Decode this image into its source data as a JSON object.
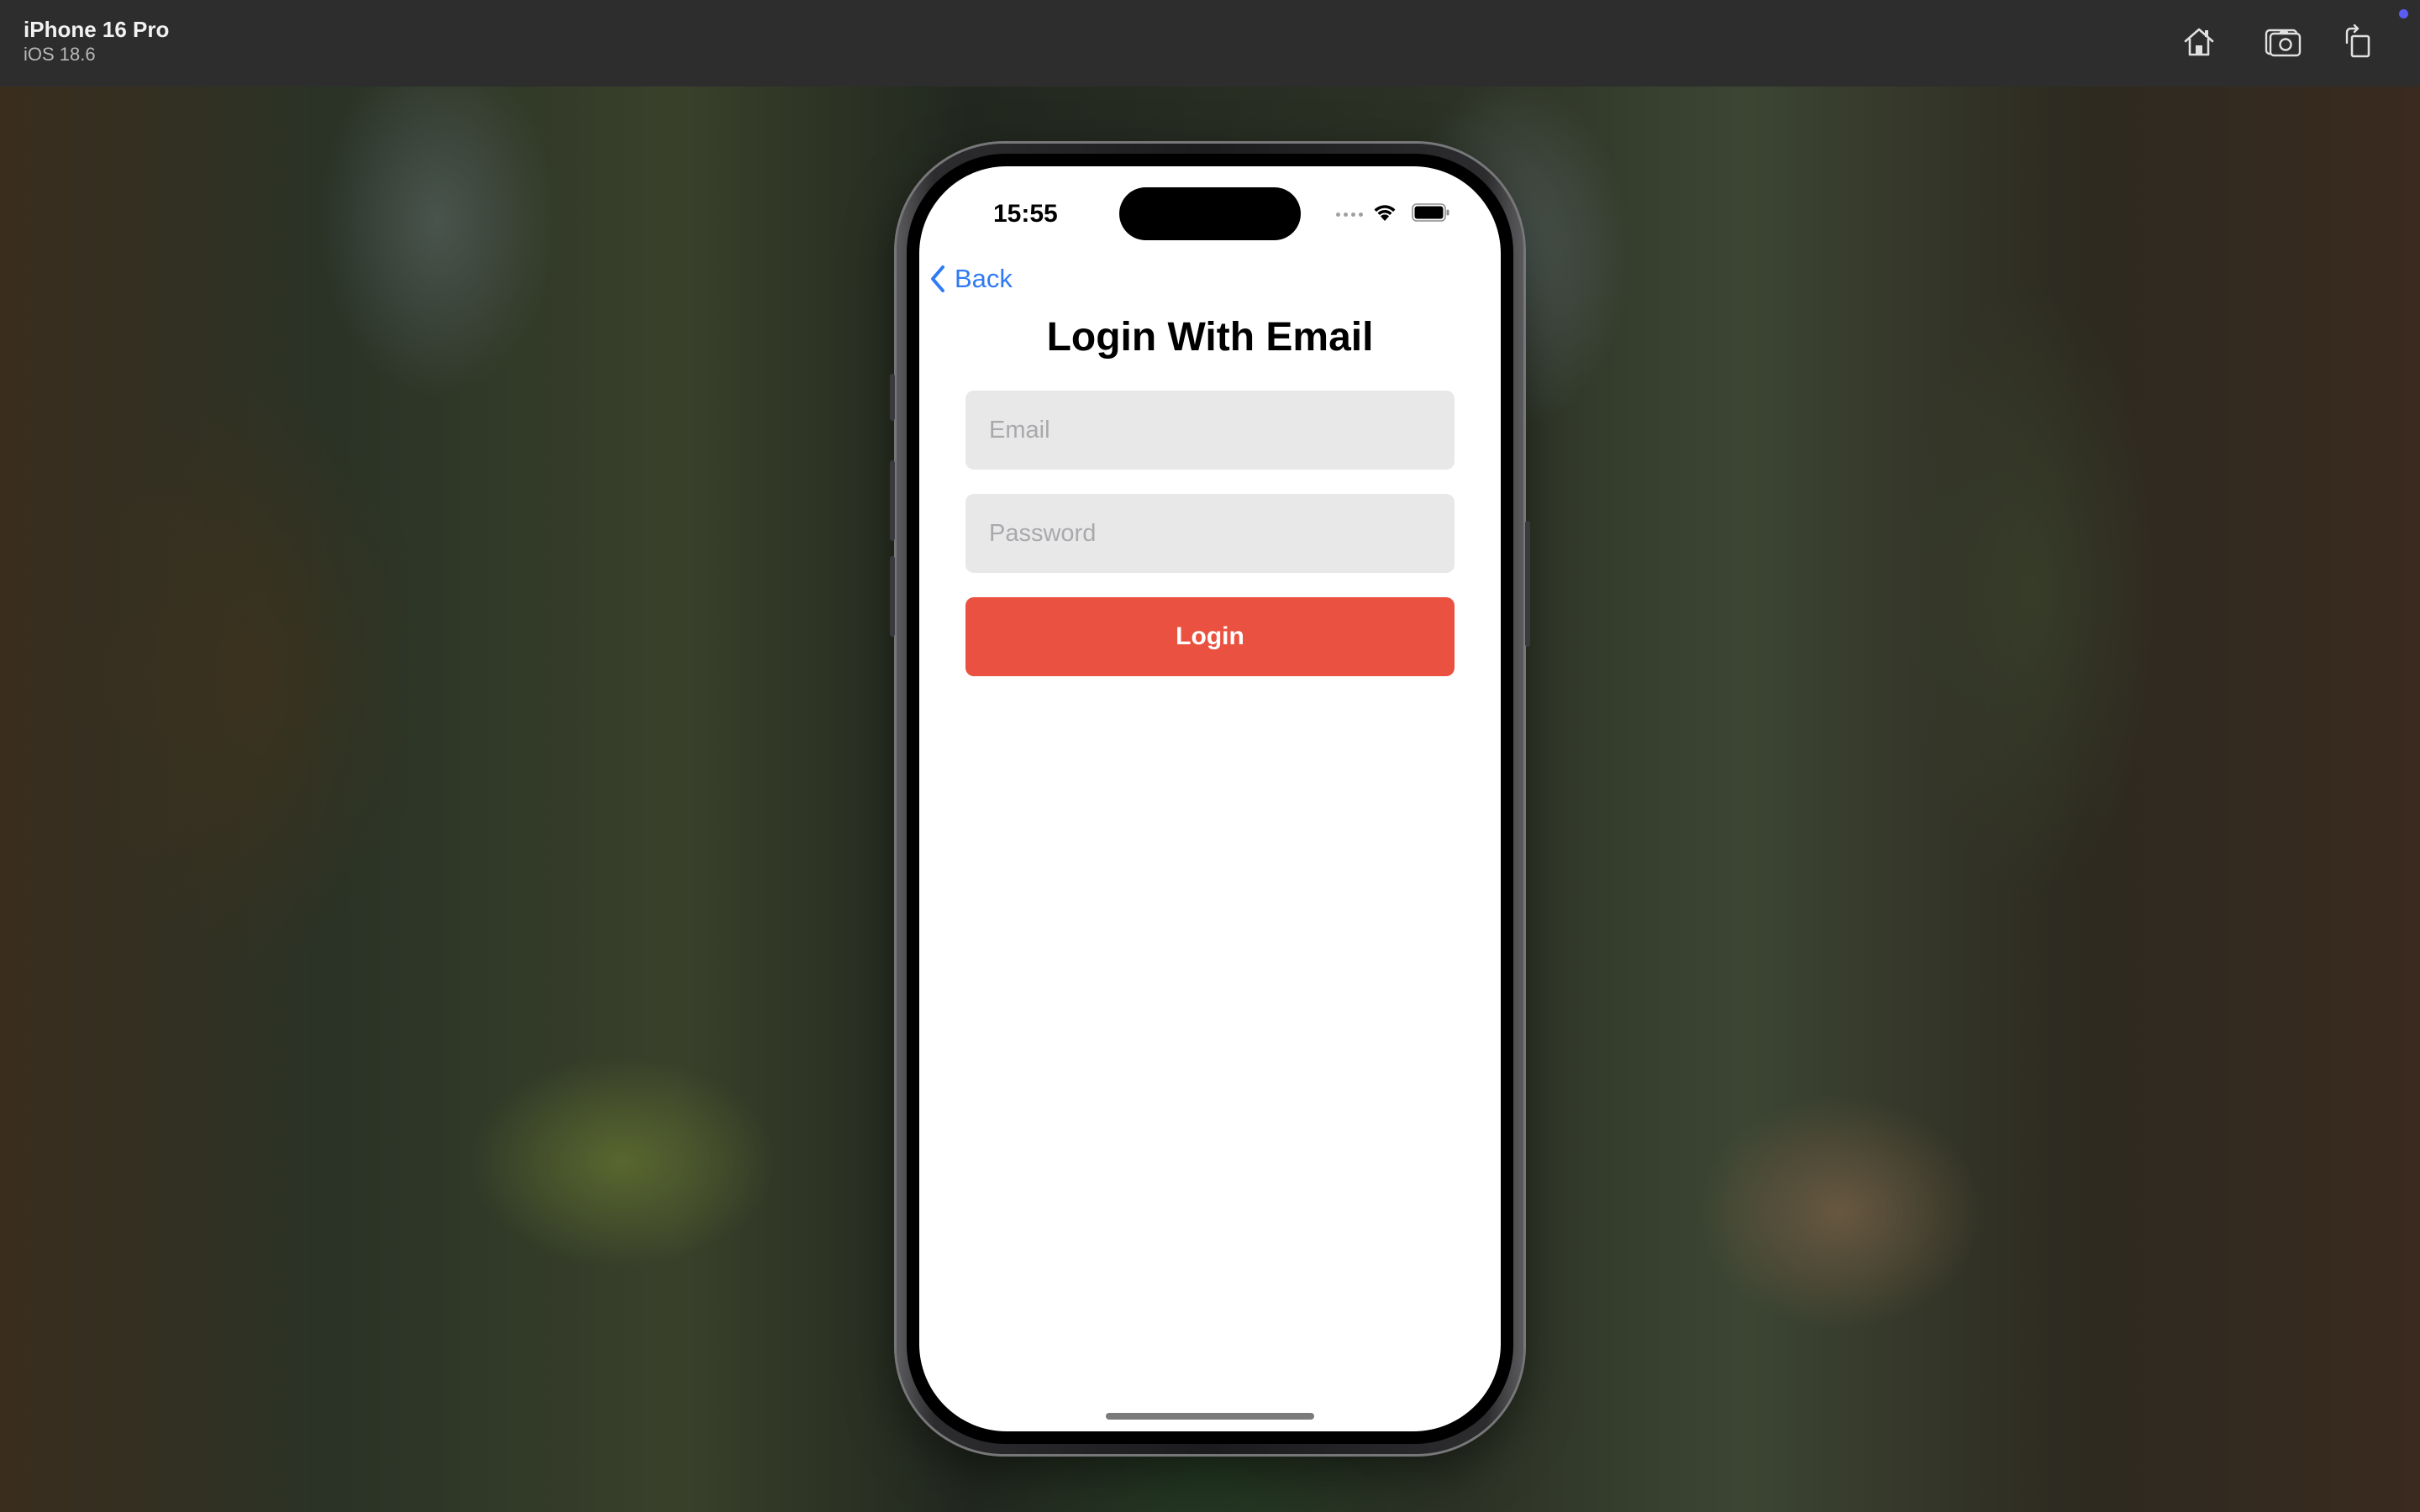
{
  "simulator": {
    "device_name": "iPhone 16 Pro",
    "os_version": "iOS 18.6",
    "toolbar": {
      "home_icon": "home-icon",
      "screenshot_icon": "camera-icon",
      "rotate_icon": "rotate-icon"
    },
    "notification_dot_color": "#5b5bf5"
  },
  "status_bar": {
    "time": "15:55",
    "wifi_icon": "wifi-icon",
    "battery_icon": "battery-icon"
  },
  "navigation": {
    "back_label": "Back",
    "back_icon": "chevron-left-icon"
  },
  "screen": {
    "title": "Login With Email",
    "email_placeholder": "Email",
    "email_value": "",
    "password_placeholder": "Password",
    "password_value": "",
    "login_label": "Login"
  },
  "colors": {
    "accent": "#2f7bf5",
    "login_button": "#ea5140",
    "field_background": "#e8e8e8"
  }
}
